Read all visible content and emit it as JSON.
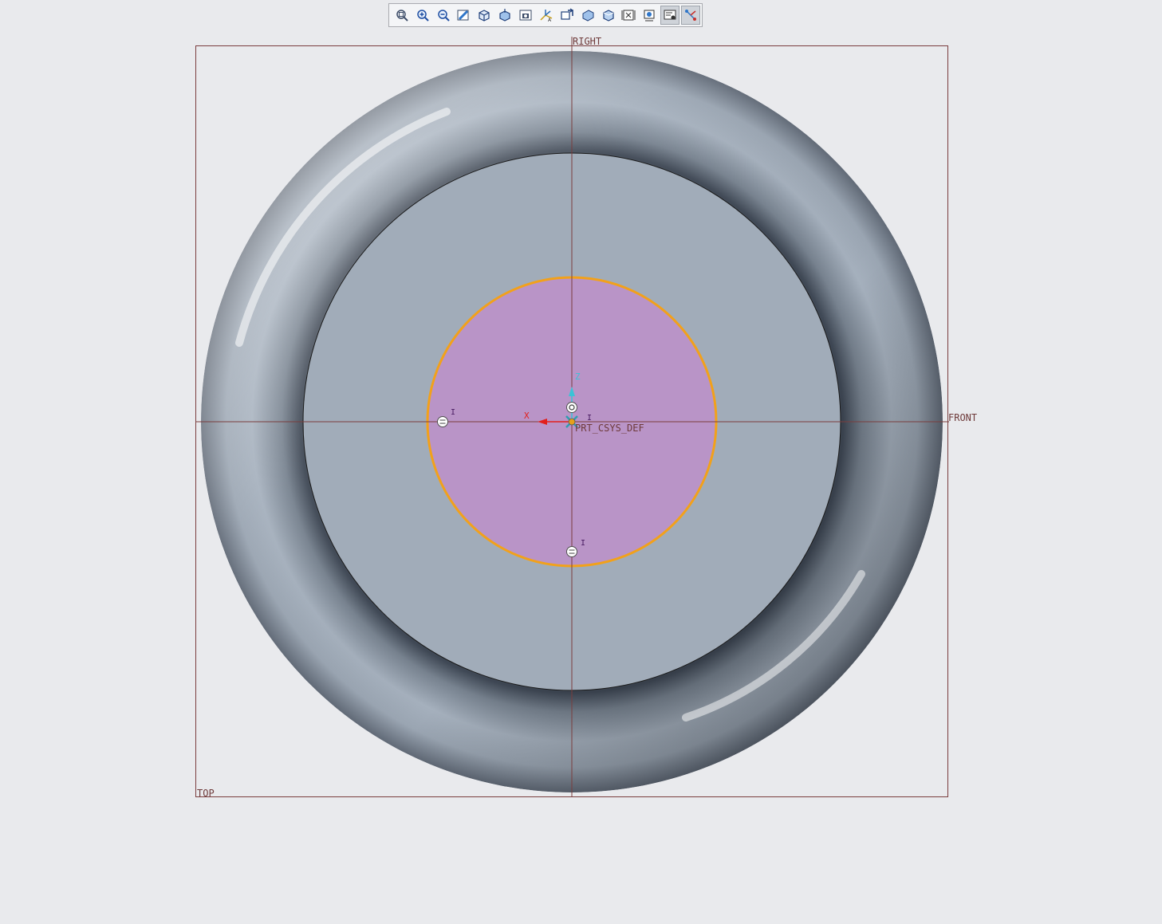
{
  "toolbar": {
    "buttons": [
      {
        "icon": "refit-icon"
      },
      {
        "icon": "zoom-in-icon"
      },
      {
        "icon": "zoom-out-icon"
      },
      {
        "icon": "repaint-icon"
      },
      {
        "icon": "display-style-icon"
      },
      {
        "icon": "saved-orientations-icon"
      },
      {
        "icon": "view-manager-icon"
      },
      {
        "icon": "datum-display-icon"
      },
      {
        "icon": "annotation-display-icon"
      },
      {
        "icon": "spin-center-icon"
      },
      {
        "icon": "perspective-icon"
      },
      {
        "icon": "section-icon"
      },
      {
        "icon": "sketch-view-icon"
      },
      {
        "icon": "sketcher-display-icon"
      },
      {
        "icon": "sketcher-constraints-icon"
      }
    ],
    "active_buttons": [
      13,
      14
    ]
  },
  "datum_planes": {
    "right_label": "RIGHT",
    "front_label": "FRONT",
    "top_label": "TOP"
  },
  "csys": {
    "name": "PRT_CSYS_DEF",
    "axis_x": "X",
    "axis_z": "Z"
  },
  "constraint_marks": {
    "left": "I",
    "bottom": "I",
    "center": "I"
  },
  "colors": {
    "background": "#e9eaed",
    "datum_line": "#7a3d3d",
    "sketch_circle": "#f2a11a",
    "sketch_fill": "#b994c7",
    "part_face": "#a1acb9",
    "part_edge": "#1a1a1a",
    "axis_x": "#e2201c",
    "axis_z": "#3ac3d6"
  }
}
